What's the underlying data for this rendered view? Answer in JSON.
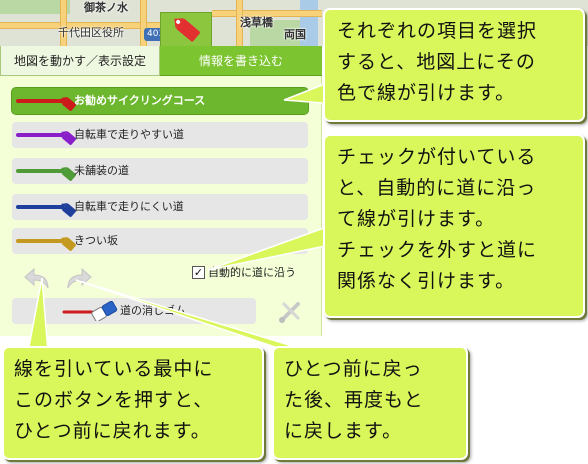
{
  "map": {
    "labels": {
      "ochanomizu": "御茶ノ水",
      "chiyoda": "千代田区役所",
      "asakusabashi": "浅草橋",
      "ryogoku": "両国"
    },
    "route_number": "403"
  },
  "panel": {
    "tabs": {
      "move": "地図を動かす／表示設定",
      "write": "情報を書き込む"
    },
    "roads": [
      {
        "label": "お勧めサイクリングコース",
        "color": "#cc1b1b",
        "selected": true
      },
      {
        "label": "自転車で走りやすい道",
        "color": "#8a1fc9",
        "selected": false
      },
      {
        "label": "未舗装の道",
        "color": "#4f9b38",
        "selected": false
      },
      {
        "label": "自転車で走りにくい道",
        "color": "#1e3f9c",
        "selected": false
      },
      {
        "label": "きつい坂",
        "color": "#c39a1f",
        "selected": false
      }
    ],
    "checkbox": {
      "label": "自動的に道に沿う",
      "checked": true,
      "mark": "✓"
    },
    "undo_icon": "undo-arrow-icon",
    "redo_icon": "redo-arrow-icon",
    "erase_label": "道の消しゴム",
    "tool_icon": "scissors-tool-icon"
  },
  "callouts": {
    "select": [
      "それぞれの項目を選択",
      "すると、地図上にその",
      "色で線が引けます。"
    ],
    "check": [
      "チェックが付いている",
      "と、自動的に道に沿っ",
      "て線が引けます。",
      "チェックを外すと道に",
      "関係なく引けます。"
    ],
    "undo": [
      "線を引いている最中に",
      "このボタンを押すと、",
      "ひとつ前に戻れます。"
    ],
    "redo": [
      "ひとつ前に戻っ",
      "た後、再度もと",
      "に戻します。"
    ]
  },
  "colors": {
    "panel_bg": "#f4ffd8",
    "tab_active": "#7dc431",
    "callout_bg": "#d9f65a",
    "selected_row": "#6cb72d"
  }
}
